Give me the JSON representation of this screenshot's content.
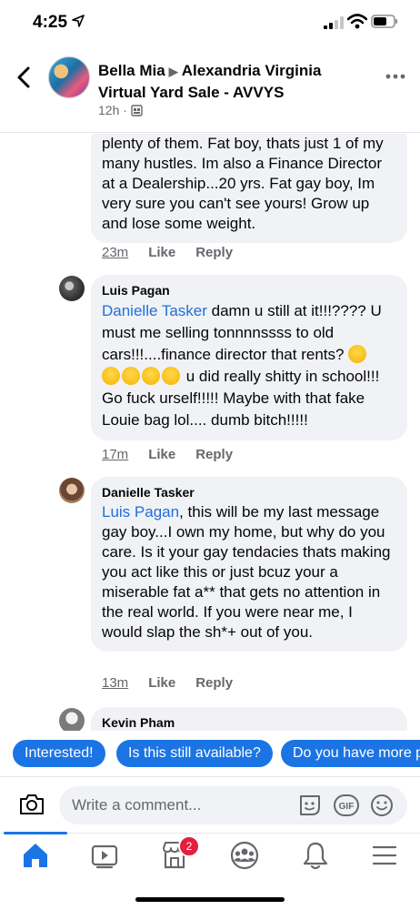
{
  "status_bar": {
    "time": "4:25"
  },
  "header": {
    "author": "Bella Mia",
    "group": "Alexandria Virginia Virtual Yard Sale - AVVYS",
    "time": "12h ·"
  },
  "comments": [
    {
      "text": "plenty of them. Fat boy, thats just 1 of my many hustles. Im also a Finance Director at a Dealership...20 yrs. Fat gay boy, Im very sure you can't see yours! Grow up and lose some weight.",
      "time": "23m",
      "like": "Like",
      "reply": "Reply"
    },
    {
      "author": "Luis Pagan",
      "mention": "Danielle Tasker",
      "text_1": " damn u still at it!!!???? U must me selling tonnnnssss to old cars!!!....finance director that rents?",
      "text_2": " u did really shitty in school!!! Go fuck urself!!!!! Maybe with that fake Louie bag lol.... dumb bitch!!!!!",
      "time": "17m",
      "like": "Like",
      "reply": "Reply"
    },
    {
      "author": "Danielle Tasker",
      "mention": "Luis Pagan",
      "text": ", this will be my last message gay boy...I own my home, but why do you care. Is it your gay tendacies thats making you act like this or just bcuz your a miserable fat a** that gets no attention in the real world. If you were near me, I would slap the sh*+ out of you.",
      "time": "13m",
      "like": "Like",
      "reply": "Reply"
    },
    {
      "author": "Kevin Pham"
    }
  ],
  "quick_replies": [
    "Interested!",
    "Is this still available?",
    "Do you have more p"
  ],
  "composer": {
    "placeholder": "Write a comment..."
  },
  "tab_bar": {
    "active": "home",
    "marketplace_badge": "2",
    "icons": [
      "home-icon",
      "watch-icon",
      "marketplace-icon",
      "groups-icon",
      "notifications-icon",
      "menu-icon"
    ]
  },
  "colors": {
    "accent": "#1b74e4",
    "mention": "#216fdb",
    "bubble": "#f0f2f5",
    "badge": "#e41e3f"
  }
}
